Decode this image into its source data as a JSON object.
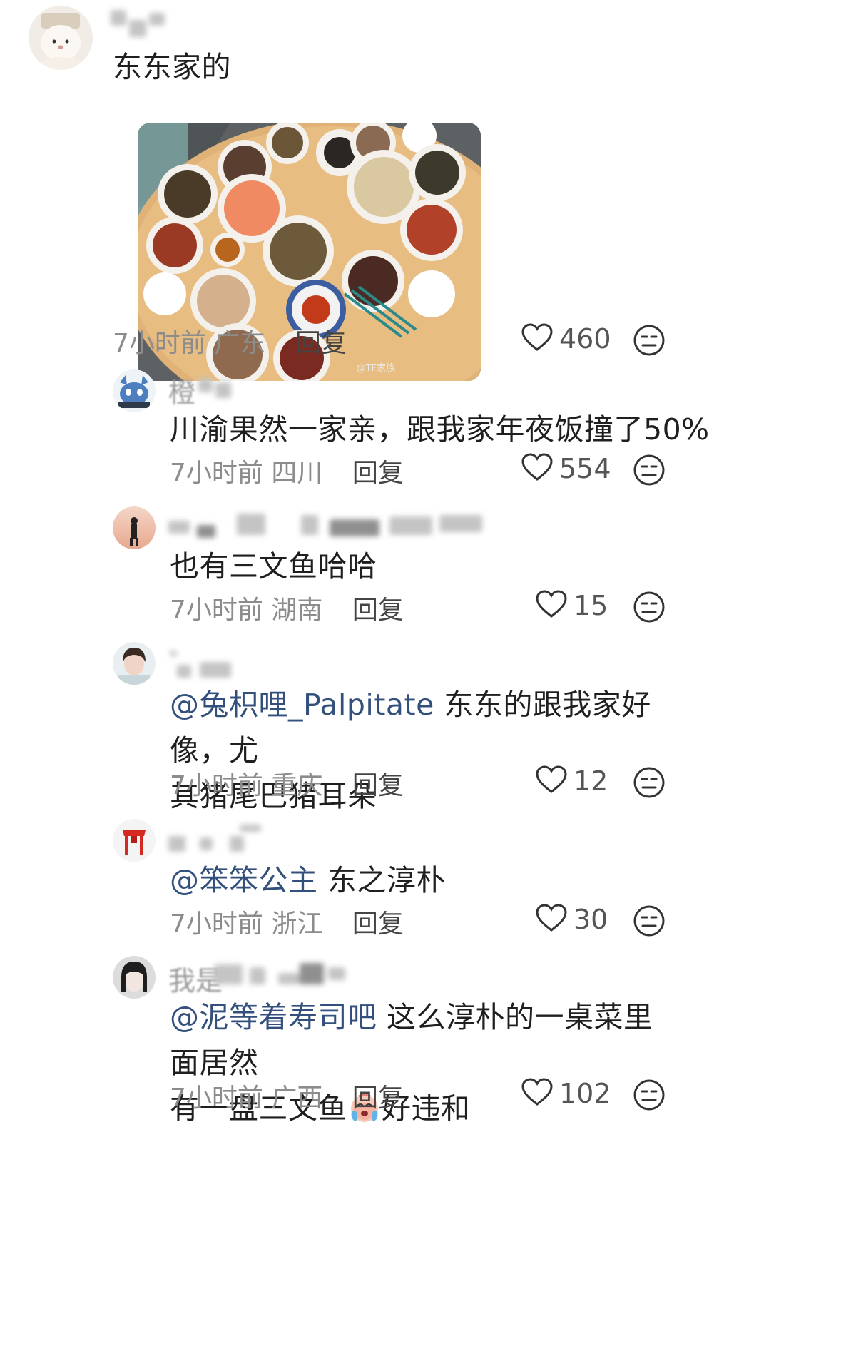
{
  "comments": [
    {
      "text": "东东家的",
      "time": "7小时前",
      "location": "广东",
      "reply": "回复",
      "likes": "460",
      "has_image": true,
      "image_watermark": "@TF家族"
    },
    {
      "username_visible": "橙",
      "text": "川渝果然一家亲，跟我家年夜饭撞了50%",
      "time": "7小时前",
      "location": "四川",
      "reply": "回复",
      "likes": "554"
    },
    {
      "username_visible": "",
      "text": "也有三文鱼哈哈",
      "time": "7小时前",
      "location": "湖南",
      "reply": "回复",
      "likes": "15"
    },
    {
      "mention": "@兔枳哩_Palpitate",
      "text_line1": " 东东的跟我家好像，尤",
      "text_line2": "其猪尾巴猪耳朵",
      "time": "7小时前",
      "location": "重庆",
      "reply": "回复",
      "likes": "12"
    },
    {
      "mention": "@笨笨公主",
      "text": " 东之淳朴",
      "time": "7小时前",
      "location": "浙江",
      "reply": "回复",
      "likes": "30"
    },
    {
      "username_visible": "我是",
      "mention": "@泥等着寿司吧",
      "text_line1": " 这么淳朴的一桌菜里面居然",
      "text_line2a": "有一盘三文鱼",
      "text_line2b": "好违和",
      "time": "7小时前",
      "location": "广西",
      "reply": "回复",
      "likes": "102"
    }
  ],
  "icons": {
    "like": "heart-outline-icon",
    "dislike": "meh-face-icon",
    "emoji": "crying-face-emoji"
  },
  "colors": {
    "mention": "#33507d",
    "meta": "#8c8c8c",
    "text": "#1f1f1f"
  }
}
